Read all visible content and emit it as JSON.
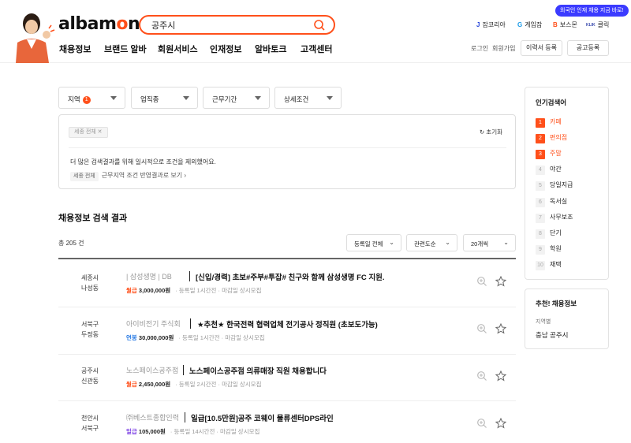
{
  "header": {
    "logo_text": "albamon",
    "search_value": "공주시",
    "promo": "외국인 인재 채용 지금 바로!",
    "family_sites": [
      {
        "label": "잡코리아",
        "icon": "J"
      },
      {
        "label": "게임잡",
        "icon": "G"
      },
      {
        "label": "보스몬",
        "icon": "B"
      },
      {
        "label": "클릭",
        "icon": "KLIK"
      }
    ],
    "nav": [
      "채용정보",
      "브랜드 알바",
      "회원서비스",
      "인재정보",
      "알바토크",
      "고객센터"
    ],
    "util": {
      "login": "로그인",
      "signup": "회원가입"
    },
    "resume_button": "이력서 등록",
    "post_button": "공고등록",
    "accent": "#ff501b"
  },
  "filters": {
    "selects": [
      {
        "label": "지역",
        "count": "1"
      },
      {
        "label": "업직종"
      },
      {
        "label": "근무기간"
      },
      {
        "label": "상세조건"
      }
    ],
    "chip": "세종 전체",
    "reset": "초기화",
    "notice": "더 많은 검색결과를 위해 일시적으로 조건을 제외했어요.",
    "notice_tag": "세종 전체",
    "notice_link": "근무지역 조건 반영결과로 보기"
  },
  "results": {
    "title": "채용정보 검색 결과",
    "total": "총 205 건",
    "dropdowns": [
      "등록일 전체",
      "관련도순",
      "20개씩"
    ],
    "rows": [
      {
        "loc1": "세종시",
        "loc2": "나성동",
        "company": "| 삼성생명 | DB",
        "title": "[신입/경력] 초보#주부#투잡# 친구와 함께 삼성생명 FC 지원.",
        "pay_type": "월급",
        "pay_color": "#ff501b",
        "amount": "3,000,000원",
        "posted": "등록일 1시간전",
        "deadline": "마감일 상시모집"
      },
      {
        "loc1": "서북구",
        "loc2": "두정동",
        "company": "아이비전기 주식회",
        "title": "★추천★ 한국전력 협력업체 전기공사 정직원 (초보도가능)",
        "pay_type": "연봉",
        "pay_color": "#2a7be4",
        "amount": "30,000,000원",
        "posted": "등록일 1시간전",
        "deadline": "마감일 상시모집"
      },
      {
        "loc1": "공주시",
        "loc2": "신관동",
        "company": "노스페이스공주점",
        "title": "노스페이스공주점 의류매장 직원 채용합니다",
        "pay_type": "월급",
        "pay_color": "#ff501b",
        "amount": "2,450,000원",
        "posted": "등록일 2시간전",
        "deadline": "마감일 상시모집"
      },
      {
        "loc1": "천안시",
        "loc2": "서북구",
        "company": "㈜베스트종합인력",
        "title": "일급[10.5만원]공주 코웨이 물류센터DPS라인",
        "pay_type": "일급",
        "pay_color": "#7b3fe4",
        "amount": "105,000원",
        "posted": "등록일 14시간전",
        "deadline": "마감일 상시모집"
      }
    ]
  },
  "sidebar": {
    "popular_title": "인기검색어",
    "popular": [
      "카페",
      "편의점",
      "주말",
      "야간",
      "당일지급",
      "독서실",
      "사무보조",
      "단기",
      "학원",
      "재택"
    ],
    "rec_title": "추천! 채용정보",
    "rec_sub": "지역별",
    "rec_value": "충남 공주시"
  }
}
